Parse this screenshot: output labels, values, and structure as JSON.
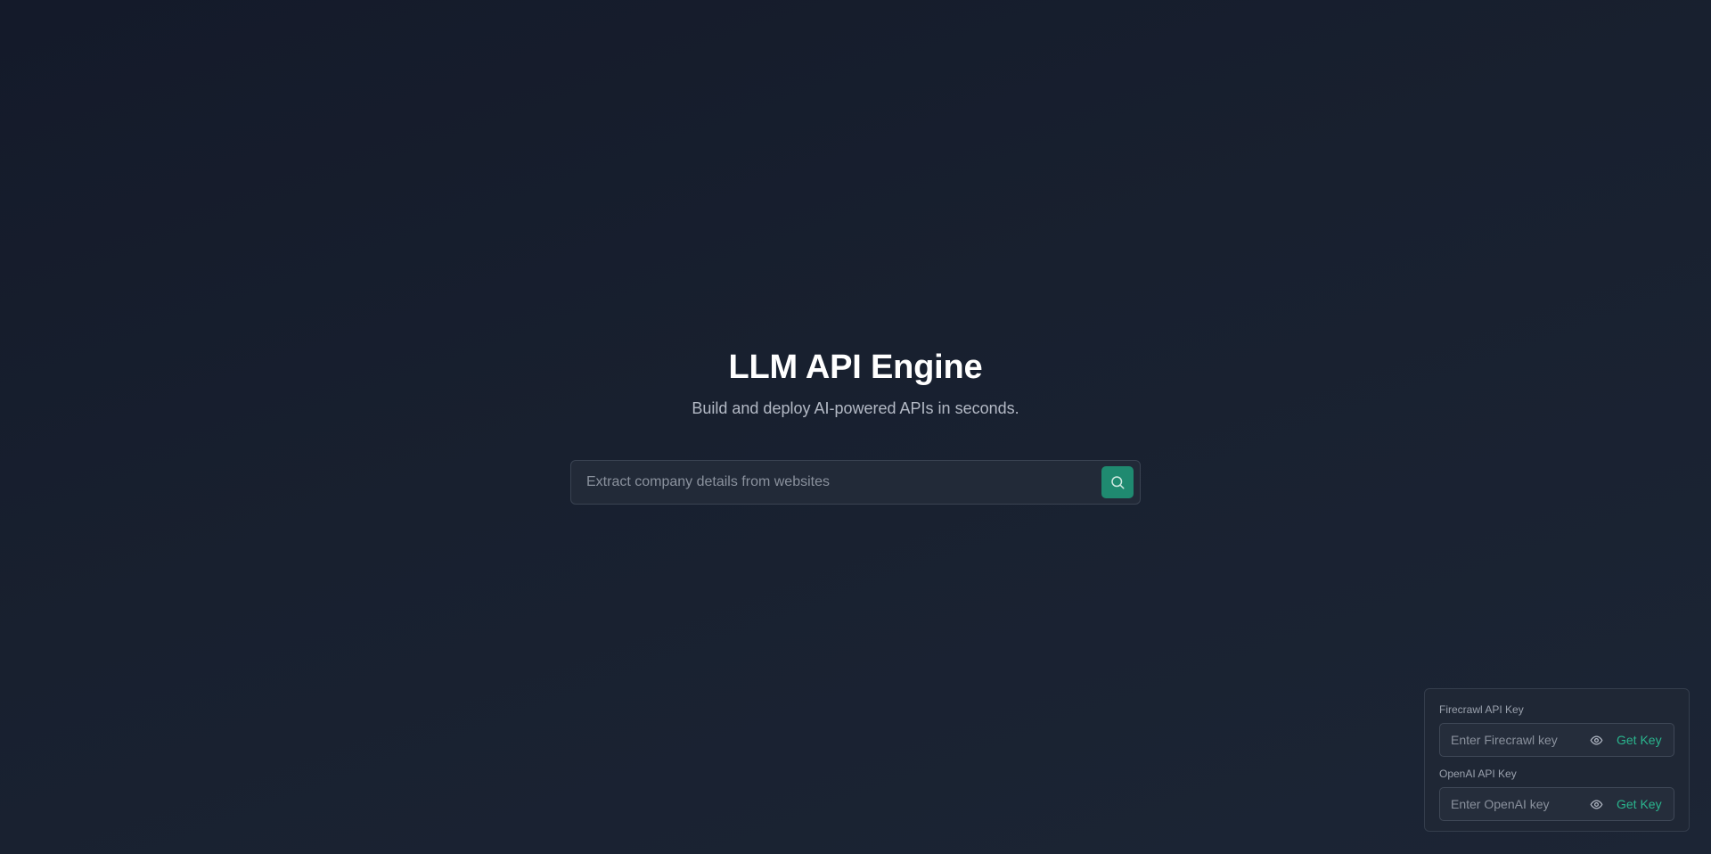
{
  "hero": {
    "title": "LLM API Engine",
    "subtitle": "Build and deploy AI-powered APIs in seconds."
  },
  "search": {
    "placeholder": "Extract company details from websites",
    "value": "",
    "button_icon": "search-icon"
  },
  "api_keys": {
    "firecrawl": {
      "label": "Firecrawl API Key",
      "placeholder": "Enter Firecrawl key",
      "value": "",
      "toggle_icon": "eye-icon",
      "link_label": "Get Key"
    },
    "openai": {
      "label": "OpenAI API Key",
      "placeholder": "Enter OpenAI key",
      "value": "",
      "toggle_icon": "eye-icon",
      "link_label": "Get Key"
    }
  },
  "colors": {
    "accent": "#1f8a70",
    "link": "#2ab58e",
    "background": "#18202f"
  }
}
